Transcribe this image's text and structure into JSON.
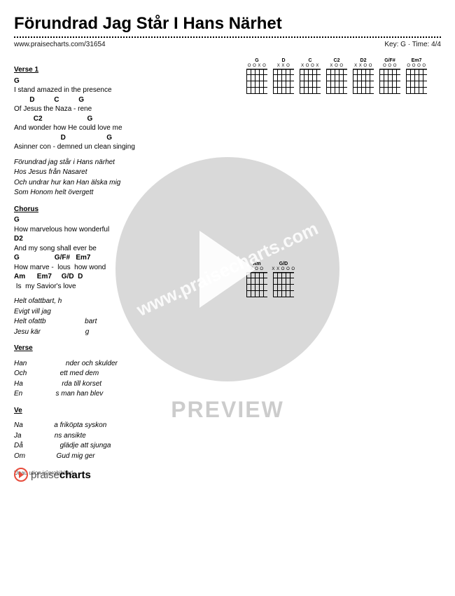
{
  "title": "Förundrad Jag Står I Hans Närhet",
  "meta": {
    "url": "www.praisecharts.com/31654",
    "key_label": "Key: G",
    "time_label": "Time: 4/4",
    "separator": " · "
  },
  "chord_diagrams": [
    {
      "name": "G",
      "fingers": "O O     X O"
    },
    {
      "name": "D",
      "fingers": "X X O"
    },
    {
      "name": "C",
      "fingers": "X     O   O X"
    },
    {
      "name": "C2",
      "fingers": "X     O    O"
    },
    {
      "name": "D2",
      "fingers": "X X O    O"
    },
    {
      "name": "G/F#",
      "fingers": "O O O"
    },
    {
      "name": "Em7",
      "fingers": "O O O    O"
    },
    {
      "name": "Am",
      "fingers": "X O       O"
    },
    {
      "name": "G/D",
      "fingers": "X X  O O O"
    }
  ],
  "sections": [
    {
      "title": "Verse 1",
      "lines": [
        {
          "chord": "G",
          "text": ""
        },
        {
          "chord": "",
          "text": "I stand amazed in the presence"
        },
        {
          "chord": "        D          C          G",
          "text": ""
        },
        {
          "chord": "",
          "text": "Of Jesus the Naza - rene"
        },
        {
          "chord": "          C2                       G",
          "text": ""
        },
        {
          "chord": "",
          "text": "And wonder how He could love me"
        },
        {
          "chord": "                        D                     G",
          "text": ""
        },
        {
          "chord": "",
          "text": "Asinner con - demned un clean singing"
        }
      ],
      "italic": [
        "Förundrad jag står i Hans närhet",
        "Hos Jesus från Nasaret",
        "Och undrar hur kan Han älska mig",
        "Som Honom helt övergett"
      ]
    },
    {
      "title": "Chorus",
      "lines": [
        {
          "chord": "G",
          "text": ""
        },
        {
          "chord": "",
          "text": "How marvelous how wonderful"
        },
        {
          "chord": "D2",
          "text": ""
        },
        {
          "chord": "",
          "text": "And my song shall ever be"
        },
        {
          "chord": "G                  G/F#   Em7",
          "text": ""
        },
        {
          "chord": "",
          "text": "How marve -  lous  how wond"
        },
        {
          "chord": "Am      Em7     G/D  D",
          "text": ""
        },
        {
          "chord": "",
          "text": " Is  my Savior's love "
        }
      ],
      "italic": [
        "Helt ofattbart, h",
        "Evigt vill jag",
        "Helt ofattb                    bart",
        "Jesu kär                       g"
      ]
    },
    {
      "title": "Verse",
      "italic": [
        "Han                    nder och skulder",
        "Och                 ett med dem",
        "Ha                    rda till korset",
        "En                 s man han blev"
      ]
    },
    {
      "title": "Ve",
      "italic": [
        "Na                a friköpta syskon",
        "Ja                 ns ansikte",
        "Då                   glädje att sjunga",
        "Om                Gud mig ger"
      ]
    }
  ],
  "unauthorized": "Unau                  ution is prohibited.",
  "watermark_text": "www.praisecharts.com",
  "preview_label": "PREVIEW",
  "footer_brand_prefix": "praise",
  "footer_brand_suffix": "charts"
}
